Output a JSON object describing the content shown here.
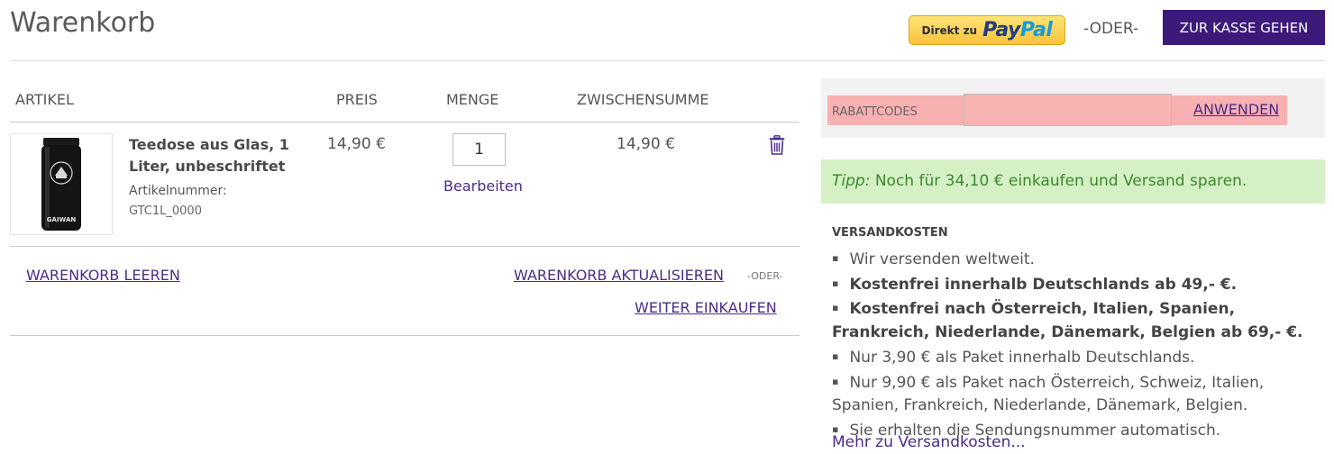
{
  "page": {
    "title": "Warenkorb"
  },
  "top": {
    "paypal_small": "Direkt zu",
    "paypal_pay": "Pay",
    "paypal_pal": "Pal",
    "oder": "-ODER-",
    "checkout_label": "ZUR KASSE GEHEN"
  },
  "cart": {
    "columns": {
      "artikel": "ARTIKEL",
      "preis": "PREIS",
      "menge": "MENGE",
      "zwischensumme": "ZWISCHENSUMME"
    },
    "items": [
      {
        "name": "Teedose aus Glas, 1 Liter, unbeschriftet",
        "sku_label": "Artikelnummer:",
        "sku": "GTC1L_0000",
        "price": "14,90 €",
        "qty": "1",
        "edit_label": "Bearbeiten",
        "subtotal": "14,90 €",
        "thumb_brand": "GAIWAN"
      }
    ],
    "actions": {
      "clear": "WARENKORB LEEREN",
      "update": "WARENKORB AKTUALISIEREN",
      "oder": "-ODER-",
      "continue": "WEITER EINKAUFEN"
    }
  },
  "coupon": {
    "label": "RABATTCODES",
    "input_value": "",
    "apply": "ANWENDEN"
  },
  "tip": {
    "prefix": "Tipp:",
    "text": "Noch für 34,10 € einkaufen und Versand sparen."
  },
  "shipping": {
    "heading": "VERSANDKOSTEN",
    "items": [
      "Wir versenden weltweit.",
      "Kostenfrei innerhalb Deutschlands ab 49,- €.",
      "Kostenfrei nach Österreich, Italien, Spanien, Frankreich, Niederlande, Dänemark, Belgien ab 69,- €.",
      "Nur 3,90 € als Paket innerhalb Deutschlands.",
      "Nur 9,90 € als Paket nach Österreich, Schweiz, Italien, Spanien, Frankreich, Niederlande, Dänemark, Belgien.",
      "Sie erhalten die Sendungsnummer automatisch."
    ],
    "more": "Mehr zu Versandkosten..."
  },
  "colors": {
    "accent": "#3b1a7a",
    "link": "#4a2c8a",
    "tip_bg": "#d6f0c6",
    "tip_text": "#3a8a2a",
    "coupon_highlight": "#f7b1b1"
  }
}
